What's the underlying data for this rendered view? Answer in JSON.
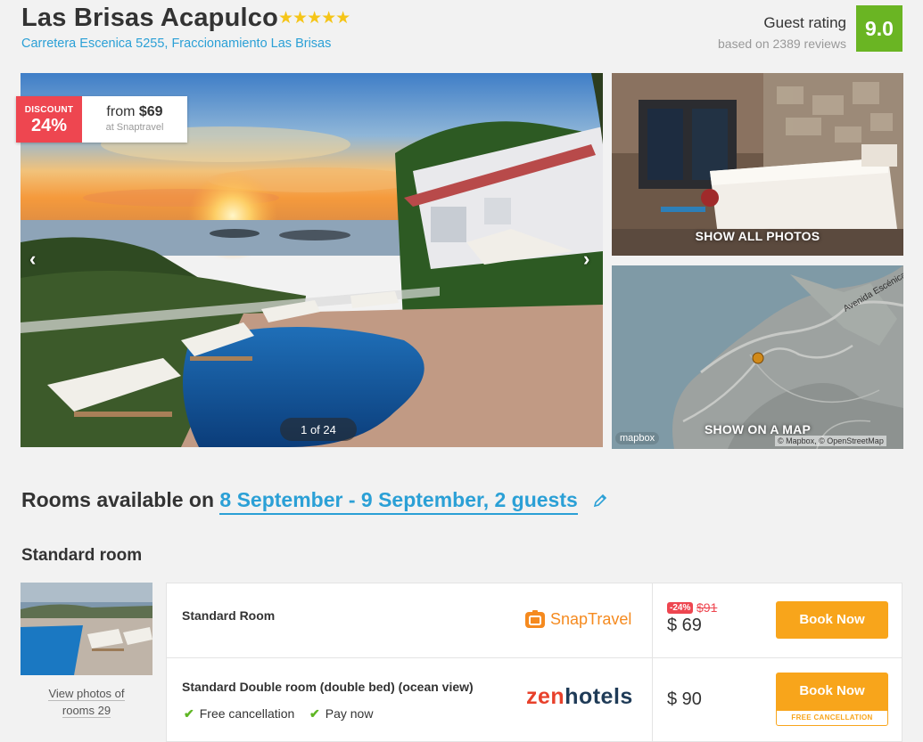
{
  "hotel": {
    "name": "Las Brisas Acapulco",
    "stars": "★★★★★",
    "address": "Carretera Escenica 5255, Fraccionamiento Las Brisas",
    "rating_label": "Guest rating",
    "rating_sub": "based on 2389 reviews",
    "rating_value": "9.0"
  },
  "gallery": {
    "discount_label": "DISCOUNT",
    "discount_value": "24%",
    "from_text": "from",
    "from_price": "$69",
    "from_source": "at Snaptravel",
    "prev_icon": "‹",
    "next_icon": "›",
    "counter": "1 of 24",
    "show_all": "SHOW ALL PHOTOS",
    "show_map": "SHOW ON A MAP",
    "map_logo": "mapbox",
    "map_credit": "© Mapbox, © OpenStreetMap",
    "map_road": "Avenida Escénica"
  },
  "rooms": {
    "heading_prefix": "Rooms available on",
    "heading_dates": "8 September - 9 September, 2 guests",
    "room_type": "Standard room",
    "view_photos_line1": "View photos of",
    "view_photos_line2": "rooms 29",
    "offers": [
      {
        "name": "Standard Room",
        "provider": "SnapTravel",
        "badge": "-24%",
        "old_price": "$91",
        "price": "$ 69",
        "button": "Book Now"
      },
      {
        "name": "Standard Double room (double bed) (ocean view)",
        "provider": "zenhotels",
        "features": [
          "Free cancellation",
          "Pay now"
        ],
        "price": "$ 90",
        "button": "Book Now",
        "button_note": "FREE CANCELLATION"
      }
    ]
  },
  "colors": {
    "accent": "#2ba0d6",
    "rating_green": "#6ab523",
    "discount_red": "#ee4650",
    "book_orange": "#f8a51b",
    "snaptravel_orange": "#f58a1f",
    "zenhotels_red": "#e8412b",
    "zenhotels_navy": "#1f3b57"
  }
}
